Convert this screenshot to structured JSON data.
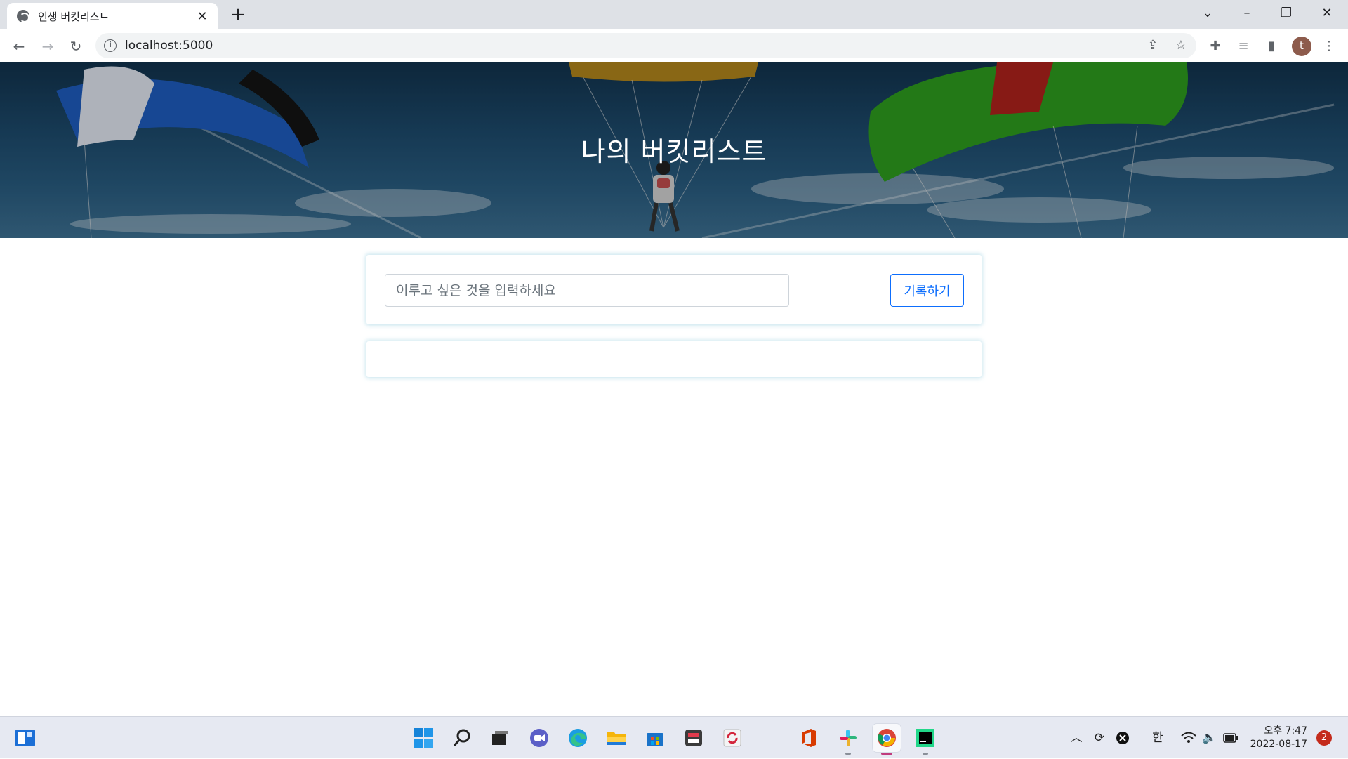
{
  "browser": {
    "tab_title": "인생 버킷리스트",
    "url": "localhost:5000",
    "avatar_letter": "t"
  },
  "page": {
    "heading": "나의 버킷리스트",
    "input_placeholder": "이루고 싶은 것을 입력하세요",
    "input_value": "",
    "submit_label": "기록하기"
  },
  "taskbar": {
    "pinned": [
      "widgets-icon",
      "start-icon",
      "search-icon",
      "task-view-icon",
      "teams-chat-icon",
      "edge-icon",
      "file-explorer-icon",
      "store-icon",
      "app-icon",
      "sync-app-icon",
      "office-icon",
      "slack-icon",
      "chrome-icon",
      "pycharm-icon"
    ],
    "ime": "한",
    "time": "오후 7:47",
    "date": "2022-08-17",
    "notification_count": "2"
  },
  "colors": {
    "accent": "#0d6efd",
    "card_glow": "#add8e6"
  }
}
